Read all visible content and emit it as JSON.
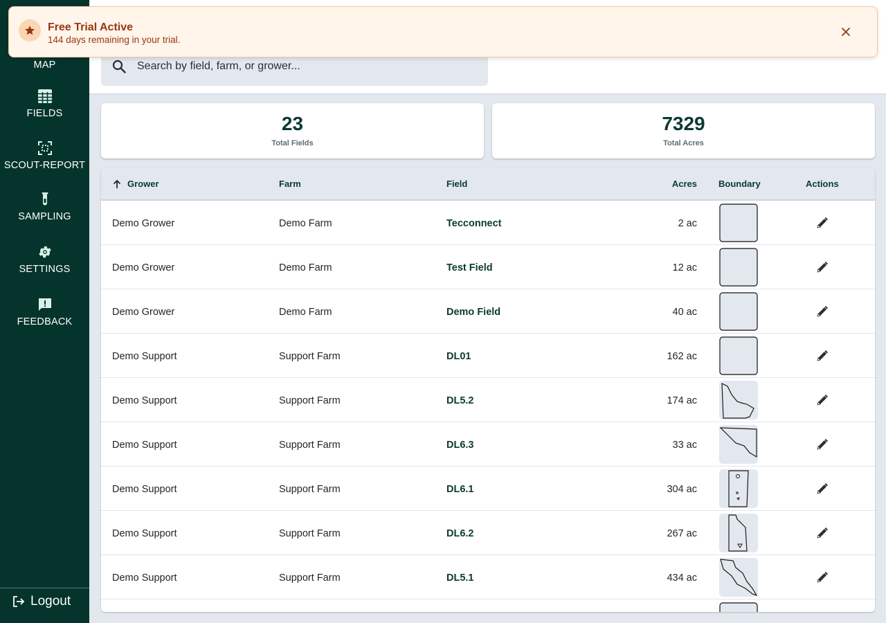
{
  "sidebar": {
    "items": [
      {
        "label": "MAP",
        "icon": "map-icon"
      },
      {
        "label": "FIELDS",
        "icon": "grid-icon"
      },
      {
        "label": "SCOUT-REPORT",
        "icon": "scan-icon"
      },
      {
        "label": "SAMPLING",
        "icon": "test-tube-icon"
      },
      {
        "label": "SETTINGS",
        "icon": "gear-icon"
      },
      {
        "label": "FEEDBACK",
        "icon": "feedback-icon"
      }
    ],
    "logout_label": "Logout"
  },
  "search": {
    "placeholder": "Search by field, farm, or grower...",
    "value": ""
  },
  "stats": {
    "total_fields_value": "23",
    "total_fields_label": "Total Fields",
    "total_acres_value": "7329",
    "total_acres_label": "Total Acres"
  },
  "table": {
    "columns": {
      "grower": "Grower",
      "farm": "Farm",
      "field": "Field",
      "acres": "Acres",
      "boundary": "Boundary",
      "actions": "Actions"
    },
    "sort": {
      "column": "grower",
      "direction": "ascending"
    },
    "rows": [
      {
        "grower": "Demo Grower",
        "farm": "Demo Farm",
        "field": "Tecconnect",
        "acres": "2 ac",
        "boundary_shape": "square"
      },
      {
        "grower": "Demo Grower",
        "farm": "Demo Farm",
        "field": "Test Field",
        "acres": "12 ac",
        "boundary_shape": "square"
      },
      {
        "grower": "Demo Grower",
        "farm": "Demo Farm",
        "field": "Demo Field",
        "acres": "40 ac",
        "boundary_shape": "square"
      },
      {
        "grower": "Demo Support",
        "farm": "Support Farm",
        "field": "DL01",
        "acres": "162 ac",
        "boundary_shape": "square"
      },
      {
        "grower": "Demo Support",
        "farm": "Support Farm",
        "field": "DL5.2",
        "acres": "174 ac",
        "boundary_shape": "polygon"
      },
      {
        "grower": "Demo Support",
        "farm": "Support Farm",
        "field": "DL6.3",
        "acres": "33 ac",
        "boundary_shape": "wedge"
      },
      {
        "grower": "Demo Support",
        "farm": "Support Farm",
        "field": "DL6.1",
        "acres": "304 ac",
        "boundary_shape": "tall-strip"
      },
      {
        "grower": "Demo Support",
        "farm": "Support Farm",
        "field": "DL6.2",
        "acres": "267 ac",
        "boundary_shape": "tall-notch"
      },
      {
        "grower": "Demo Support",
        "farm": "Support Farm",
        "field": "DL5.1",
        "acres": "434 ac",
        "boundary_shape": "wedge-large"
      }
    ]
  },
  "toast": {
    "title": "Free Trial Active",
    "message": "144 days remaining in your trial.",
    "icon": "star-icon"
  },
  "colors": {
    "sidebar_bg": "#04342b",
    "accent_text": "#0b3a31",
    "toast_bg": "#fff5ea",
    "toast_text": "#9a3412"
  }
}
